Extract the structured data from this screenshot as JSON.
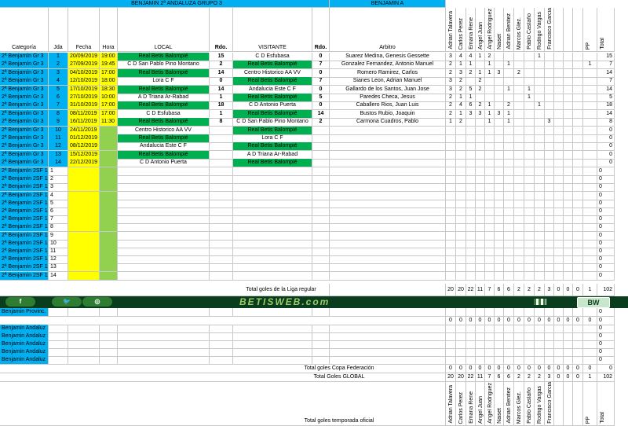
{
  "header": {
    "competition": "BENJAMIN  2ª ANDALUZA GRUPO 3",
    "team": "BENJAMIN  A"
  },
  "columns": {
    "categoria": "Categoría",
    "jda": "Jda",
    "fecha": "Fecha",
    "hora": "Hora",
    "local": "LOCAL",
    "rdo": "Rdo.",
    "visitante": "VISITANTE",
    "arbitro": "Arbitro"
  },
  "players": [
    "Adrian Talavera",
    "Carlos Perez",
    "Emana Rene",
    "Angel Juan",
    "Angel Rodriguez",
    "Naiset",
    "Adrian Benitez",
    "Marcos Glez.",
    "Pablo Castaño",
    "Rodrigo Vargas",
    "Francisco Garcia",
    "",
    "",
    "",
    "PP",
    "Total"
  ],
  "matches": [
    {
      "cat": "2ª Benjamín Gr 3",
      "jda": "1",
      "fecha": "20/09/2019",
      "hora": "19:00",
      "local": "Real Betis Balompié",
      "rl": "15",
      "visit": "C D Esfubasa",
      "rv": "0",
      "arbitro": "Suarez Medina, Genesis Gessette",
      "goals": [
        "3",
        "4",
        "4",
        "1",
        "2",
        "",
        "",
        "",
        "",
        "1",
        "",
        "",
        "",
        "",
        "",
        "15"
      ],
      "home": true
    },
    {
      "cat": "2ª Benjamín Gr 3",
      "jda": "2",
      "fecha": "27/09/2019",
      "hora": "19:45",
      "local": "C D San Pablo Pino Montano",
      "rl": "2",
      "visit": "Real Betis Balompié",
      "rv": "7",
      "arbitro": "Gonzalez Fernandez, Antonio Manuel",
      "goals": [
        "2",
        "1",
        "1",
        "",
        "1",
        "",
        "1",
        "",
        "",
        "",
        "",
        "",
        "",
        "",
        "1",
        "7"
      ],
      "home": false
    },
    {
      "cat": "2ª Benjamín Gr 3",
      "jda": "3",
      "fecha": "04/10/2019",
      "hora": "17:00",
      "local": "Real Betis Balompié",
      "rl": "14",
      "visit": "Centro Historico AA VV",
      "rv": "0",
      "arbitro": "Romero Ramirez, Carlos",
      "goals": [
        "2",
        "3",
        "2",
        "1",
        "1",
        "3",
        "",
        "2",
        "",
        "",
        "",
        "",
        "",
        "",
        "",
        "14"
      ],
      "home": true
    },
    {
      "cat": "2ª Benjamín Gr 3",
      "jda": "4",
      "fecha": "12/10/2019",
      "hora": "18:00",
      "local": "Lora C F",
      "rl": "0",
      "visit": "Real Betis Balompié",
      "rv": "7",
      "arbitro": "Sianes Leon, Adrian Manuel",
      "goals": [
        "3",
        "2",
        "",
        "2",
        "",
        "",
        "",
        "",
        "",
        "",
        "",
        "",
        "",
        "",
        "",
        "7"
      ],
      "home": false
    },
    {
      "cat": "2ª Benjamín Gr 3",
      "jda": "5",
      "fecha": "17/10/2019",
      "hora": "18:30",
      "local": "Real Betis Balompié",
      "rl": "14",
      "visit": "Andalucia Este C F",
      "rv": "0",
      "arbitro": "Gallardo de los Santos, Juan Jose",
      "goals": [
        "3",
        "2",
        "5",
        "2",
        "",
        "",
        "1",
        "",
        "1",
        "",
        "",
        "",
        "",
        "",
        "",
        "14"
      ],
      "home": true
    },
    {
      "cat": "2ª Benjamín Gr 3",
      "jda": "6",
      "fecha": "27/10/2019",
      "hora": "10:00",
      "local": "A D Triana Ar-Rabad",
      "rl": "1",
      "visit": "Real Betis Balompié",
      "rv": "5",
      "arbitro": "Paredes Checa, Jesus",
      "goals": [
        "2",
        "1",
        "1",
        "",
        "",
        "",
        "",
        "",
        "1",
        "",
        "",
        "",
        "",
        "",
        "",
        "5"
      ],
      "home": false
    },
    {
      "cat": "2ª Benjamín Gr 3",
      "jda": "7",
      "fecha": "31/10/2019",
      "hora": "17:00",
      "local": "Real Betis Balompié",
      "rl": "18",
      "visit": "C D Antonio Puerta",
      "rv": "0",
      "arbitro": "Caballero Rios, Juan Luis",
      "goals": [
        "2",
        "4",
        "6",
        "2",
        "1",
        "",
        "2",
        "",
        "",
        "1",
        "",
        "",
        "",
        "",
        "",
        "18"
      ],
      "home": true
    },
    {
      "cat": "2ª Benjamín Gr 3",
      "jda": "8",
      "fecha": "08/11/2019",
      "hora": "17:00",
      "local": "C D Esfubasa",
      "rl": "1",
      "visit": "Real Betis Balompié",
      "rv": "14",
      "arbitro": "Bustos Rubio, Joaquin",
      "goals": [
        "2",
        "1",
        "3",
        "3",
        "1",
        "3",
        "1",
        "",
        "",
        "",
        "",
        "",
        "",
        "",
        "",
        "14"
      ],
      "home": false
    },
    {
      "cat": "2ª Benjamín Gr 3",
      "jda": "9",
      "fecha": "16/11/2019",
      "hora": "11:30",
      "local": "Real Betis Balompié",
      "rl": "8",
      "visit": "C D San Pablo Pino Montano",
      "rv": "2",
      "arbitro": "Carmona Cuadros, Pablo",
      "goals": [
        "1",
        "2",
        "",
        "",
        "1",
        "",
        "1",
        "",
        "",
        "",
        "3",
        "",
        "",
        "",
        "",
        "8"
      ],
      "home": true
    },
    {
      "cat": "2ª Benjamín Gr 3",
      "jda": "10",
      "fecha": "24/11/2019",
      "hora": "",
      "local": "Centro Historico AA VV",
      "rl": "",
      "visit": "Real Betis Balompié",
      "rv": "",
      "arbitro": "",
      "goals": [
        "",
        "",
        "",
        "",
        "",
        "",
        "",
        "",
        "",
        "",
        "",
        "",
        "",
        "",
        "",
        "0"
      ],
      "home": false
    },
    {
      "cat": "2ª Benjamín Gr 3",
      "jda": "11",
      "fecha": "01/12/2019",
      "hora": "",
      "local": "Real Betis Balompié",
      "rl": "",
      "visit": "Lora C F",
      "rv": "",
      "arbitro": "",
      "goals": [
        "",
        "",
        "",
        "",
        "",
        "",
        "",
        "",
        "",
        "",
        "",
        "",
        "",
        "",
        "",
        "0"
      ],
      "home": true
    },
    {
      "cat": "2ª Benjamín Gr 3",
      "jda": "12",
      "fecha": "08/12/2019",
      "hora": "",
      "local": "Andalucia Este C F",
      "rl": "",
      "visit": "Real Betis Balompié",
      "rv": "",
      "arbitro": "",
      "goals": [
        "",
        "",
        "",
        "",
        "",
        "",
        "",
        "",
        "",
        "",
        "",
        "",
        "",
        "",
        "",
        "0"
      ],
      "home": false
    },
    {
      "cat": "2ª Benjamín Gr 3",
      "jda": "13",
      "fecha": "15/12/2019",
      "hora": "",
      "local": "Real Betis Balompié",
      "rl": "",
      "visit": "A D Triana Ar-Rabad",
      "rv": "",
      "arbitro": "",
      "goals": [
        "",
        "",
        "",
        "",
        "",
        "",
        "",
        "",
        "",
        "",
        "",
        "",
        "",
        "",
        "",
        "0"
      ],
      "home": true
    },
    {
      "cat": "2ª Benjamín Gr 3",
      "jda": "14",
      "fecha": "22/12/2019",
      "hora": "",
      "local": "C D Antonio Puerta",
      "rl": "",
      "visit": "Real Betis Balompié",
      "rv": "",
      "arbitro": "",
      "goals": [
        "",
        "",
        "",
        "",
        "",
        "",
        "",
        "",
        "",
        "",
        "",
        "",
        "",
        "",
        "",
        "0"
      ],
      "home": false
    }
  ],
  "second_phase": {
    "cat": "2ª Benjamín 2SF 1",
    "jdas": [
      "1",
      "2",
      "3",
      "4",
      "5",
      "6",
      "7",
      "8",
      "9",
      "10",
      "11",
      "12",
      "13",
      "14"
    ]
  },
  "league_total": {
    "label": "Total goles de la Liga regular",
    "values": [
      "20",
      "20",
      "22",
      "11",
      "7",
      "6",
      "6",
      "2",
      "2",
      "2",
      "3",
      "0",
      "0",
      "0",
      "1",
      "102"
    ]
  },
  "banner": {
    "icons": [
      "f",
      "twitter",
      "instagram"
    ],
    "site": "BETISWEB.com",
    "logo": "BW"
  },
  "provincial": {
    "cat": "Benjamin Provinc.",
    "values": [
      "0",
      "0",
      "0",
      "0",
      "0",
      "0",
      "0",
      "0",
      "0",
      "0",
      "0",
      "0",
      "0",
      "0",
      "0",
      "0"
    ],
    "totals": [
      "0",
      "0"
    ]
  },
  "andaluz": {
    "cat": "Benjamin Andaluz",
    "rows": 5,
    "total": "0"
  },
  "copa_total": {
    "label": "Total goles Copa Federación",
    "values": [
      "0",
      "0",
      "0",
      "0",
      "0",
      "0",
      "0",
      "0",
      "0",
      "0",
      "0",
      "0",
      "0",
      "0",
      "0",
      "0"
    ]
  },
  "global_total": {
    "label": "Total Goles GLOBAL",
    "values": [
      "20",
      "20",
      "22",
      "11",
      "7",
      "6",
      "6",
      "2",
      "2",
      "2",
      "3",
      "0",
      "0",
      "0",
      "1",
      "102"
    ]
  },
  "season_total": {
    "label": "Total goles temporada oficial"
  },
  "colors": {
    "cyan": "#00b0f0",
    "yellow": "#ffff00",
    "light_green": "#92d050",
    "green": "#00b050"
  }
}
